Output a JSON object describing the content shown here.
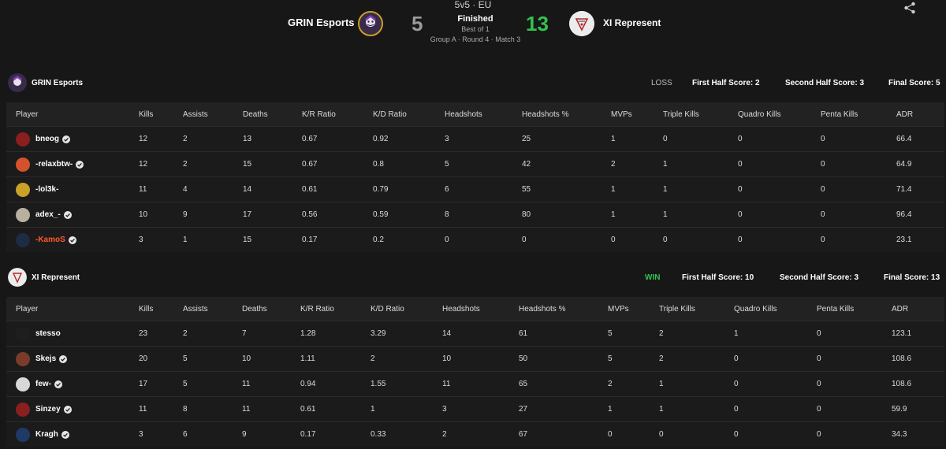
{
  "header": {
    "format": "5v5 · EU",
    "status": "Finished",
    "best_of": "Best of 1",
    "stage": "Group A · Round 4 · Match 3",
    "team_left": {
      "name": "GRIN Esports",
      "score": "5",
      "logo_icon": "grin-esports-logo"
    },
    "team_right": {
      "name": "XI Represent",
      "score": "13",
      "logo_icon": "xi-represent-logo"
    },
    "share_icon": "share-icon"
  },
  "colors": {
    "win": "#32c24d",
    "loss_score": "#9a9a9a",
    "highlight_player": "#ff5a2a",
    "background": "#171717"
  },
  "columns": [
    "Player",
    "Kills",
    "Assists",
    "Deaths",
    "K/R Ratio",
    "K/D Ratio",
    "Headshots",
    "Headshots %",
    "MVPs",
    "Triple Kills",
    "Quadro Kills",
    "Penta Kills",
    "ADR"
  ],
  "teams": [
    {
      "name": "GRIN Esports",
      "result": "LOSS",
      "first_half": "First Half Score: 2",
      "second_half": "Second Half Score: 3",
      "final": "Final Score: 5",
      "players": [
        {
          "name": "bneog",
          "verified": true,
          "stats": [
            "12",
            "2",
            "13",
            "0.67",
            "0.92",
            "3",
            "25",
            "1",
            "0",
            "0",
            "0",
            "66.4"
          ]
        },
        {
          "name": "-relaxbtw-",
          "verified": true,
          "stats": [
            "12",
            "2",
            "15",
            "0.67",
            "0.8",
            "5",
            "42",
            "2",
            "1",
            "0",
            "0",
            "64.9"
          ]
        },
        {
          "name": "-lol3k-",
          "verified": false,
          "stats": [
            "11",
            "4",
            "14",
            "0.61",
            "0.79",
            "6",
            "55",
            "1",
            "1",
            "0",
            "0",
            "71.4"
          ]
        },
        {
          "name": "adex_-",
          "verified": true,
          "stats": [
            "10",
            "9",
            "17",
            "0.56",
            "0.59",
            "8",
            "80",
            "1",
            "1",
            "0",
            "0",
            "96.4"
          ]
        },
        {
          "name": "-KamoS",
          "verified": true,
          "highlight": true,
          "stats": [
            "3",
            "1",
            "15",
            "0.17",
            "0.2",
            "0",
            "0",
            "0",
            "0",
            "0",
            "0",
            "23.1"
          ]
        }
      ]
    },
    {
      "name": "XI Represent",
      "result": "WIN",
      "first_half": "First Half Score: 10",
      "second_half": "Second Half Score: 3",
      "final": "Final Score: 13",
      "players": [
        {
          "name": "stesso",
          "verified": false,
          "stats": [
            "23",
            "2",
            "7",
            "1.28",
            "3.29",
            "14",
            "61",
            "5",
            "2",
            "1",
            "0",
            "123.1"
          ]
        },
        {
          "name": "Skejs",
          "verified": true,
          "stats": [
            "20",
            "5",
            "10",
            "1.11",
            "2",
            "10",
            "50",
            "5",
            "2",
            "0",
            "0",
            "108.6"
          ]
        },
        {
          "name": "few-",
          "verified": true,
          "stats": [
            "17",
            "5",
            "11",
            "0.94",
            "1.55",
            "11",
            "65",
            "2",
            "1",
            "0",
            "0",
            "108.6"
          ]
        },
        {
          "name": "Sinzey",
          "verified": true,
          "stats": [
            "11",
            "8",
            "11",
            "0.61",
            "1",
            "3",
            "27",
            "1",
            "1",
            "0",
            "0",
            "59.9"
          ]
        },
        {
          "name": "Kragh",
          "verified": true,
          "stats": [
            "3",
            "6",
            "9",
            "0.17",
            "0.33",
            "2",
            "67",
            "0",
            "0",
            "0",
            "0",
            "34.3"
          ]
        }
      ]
    }
  ]
}
